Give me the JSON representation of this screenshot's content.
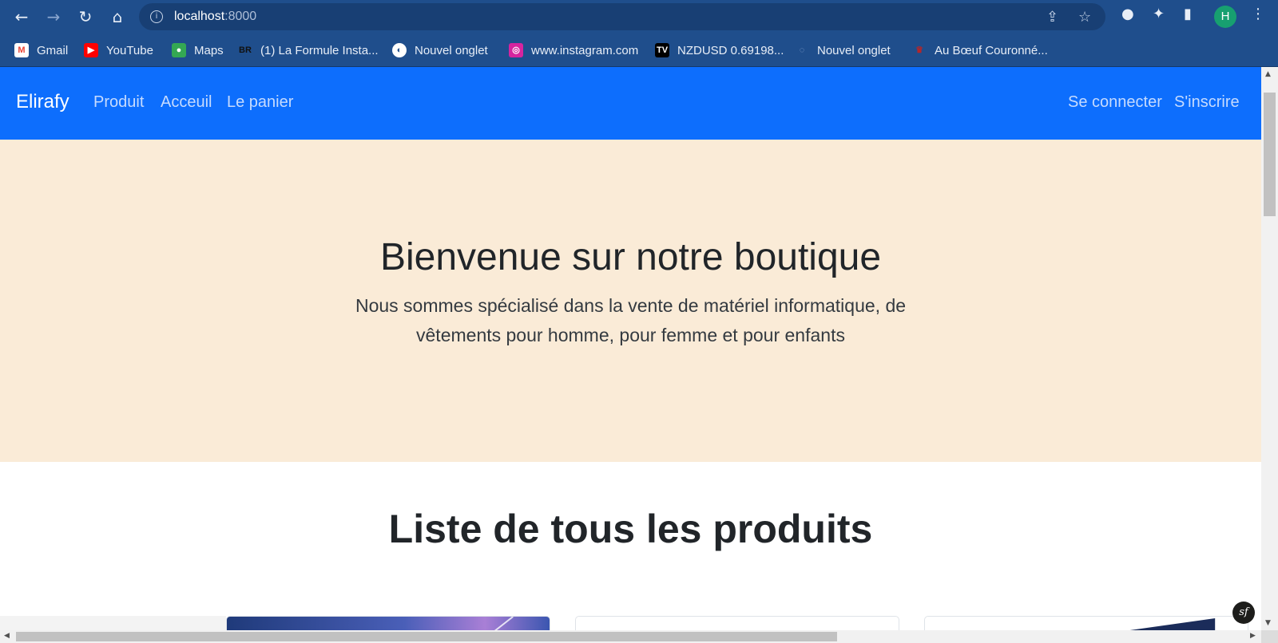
{
  "browser": {
    "url_host": "localhost",
    "url_port": ":8000",
    "profile_initial": "H",
    "bookmarks": [
      {
        "label": "Gmail",
        "icon": "gmail-icon",
        "color": "#ea4335"
      },
      {
        "label": "YouTube",
        "icon": "youtube-icon",
        "color": "#ff0000"
      },
      {
        "label": "Maps",
        "icon": "maps-icon",
        "color": "#34a853"
      },
      {
        "label": "(1) La Formule Insta...",
        "icon": "br-icon",
        "color": "#111111"
      },
      {
        "label": "Nouvel onglet",
        "icon": "globe-icon",
        "color": "#ffffff"
      },
      {
        "label": "www.instagram.com",
        "icon": "instagram-icon",
        "color": "#d6249f"
      },
      {
        "label": "NZDUSD 0.69198...",
        "icon": "tradingview-icon",
        "color": "#000000"
      },
      {
        "label": "Nouvel onglet",
        "icon": "new-tab-icon",
        "color": "#6b7f99"
      },
      {
        "label": "Au Bœuf Couronné...",
        "icon": "crown-icon",
        "color": "#b3262b"
      }
    ]
  },
  "navbar": {
    "brand": "Elirafy",
    "links": [
      "Produit",
      "Acceuil",
      "Le panier"
    ],
    "auth": [
      "Se connecter",
      "S'inscrire"
    ],
    "color": "#0d6efd"
  },
  "hero": {
    "title": "Bienvenue sur notre boutique",
    "subtitle": "Nous sommes spécialisé dans la vente de matériel informatique, de vêtements pour homme, pour femme et pour enfants",
    "background": "#faebd7"
  },
  "products": {
    "title": "Liste de tous les produits"
  },
  "symfony_badge": "sf"
}
